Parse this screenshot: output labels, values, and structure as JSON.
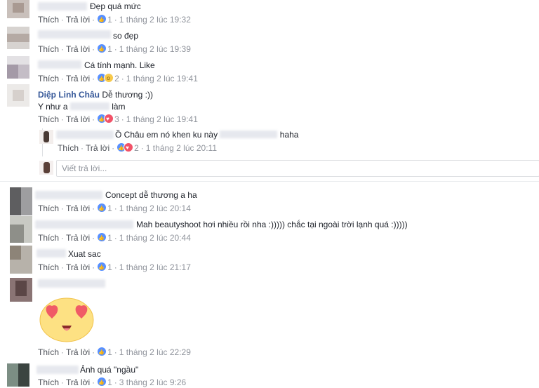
{
  "ui": {
    "like_label": "Thích",
    "reply_label": "Trả lời",
    "reply_placeholder": "Viết trả lời..."
  },
  "comments": [
    {
      "text": "Đẹp quá mức",
      "count": "1",
      "time": "1 tháng 2 lúc 19:32"
    },
    {
      "text": "so đẹp",
      "count": "1",
      "time": "1 tháng 2 lúc 19:39"
    },
    {
      "text": "Cá tính mạnh. Like",
      "count": "2",
      "time": "1 tháng 2 lúc 19:41"
    },
    {
      "author": "Diệp Linh Châu",
      "text": "Dễ thương :))",
      "text2_prefix": "Y như a",
      "text2_suffix": "làm",
      "count": "3",
      "time": "1 tháng 2 lúc 19:41"
    },
    {
      "text": "Ồ Châu em nó khen ku này",
      "text_suffix": "haha",
      "count": "2",
      "time": "1 tháng 2 lúc 20:11"
    },
    {
      "text": "Concept dễ thương a ha",
      "count": "1",
      "time": "1 tháng 2 lúc 20:14"
    },
    {
      "text": "Mah beautyshoot hơi nhiều rồi nha :))))) chắc tại ngoài trời lạnh quá :)))))",
      "count": "1",
      "time": "1 tháng 2 lúc 20:44"
    },
    {
      "text": "Xuat sac",
      "count": "1",
      "time": "1 tháng 2 lúc 21:17"
    },
    {
      "text": "",
      "count": "1",
      "time": "1 tháng 2 lúc 22:29"
    },
    {
      "text": "Ảnh quá \"ngầu\"",
      "count": "1",
      "time": "3 tháng 2 lúc 9:26"
    }
  ]
}
